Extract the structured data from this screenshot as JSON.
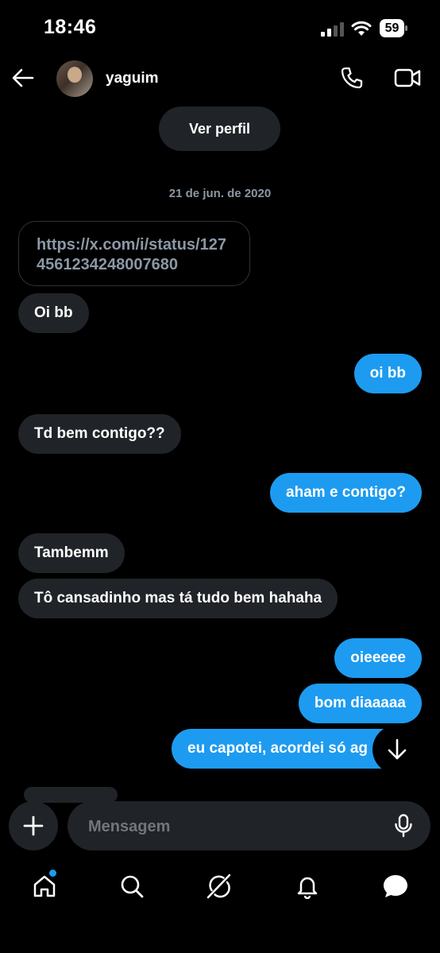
{
  "status_bar": {
    "time": "18:46",
    "battery_level": "59"
  },
  "header": {
    "contact_name": "yaguim"
  },
  "actions": {
    "view_profile": "Ver perfil"
  },
  "conversation": {
    "date": "21 de jun. de 2020",
    "link_message": "https://x.com/i/status/1274561234248007680",
    "messages": [
      {
        "side": "in",
        "text": "Oi bb"
      },
      {
        "side": "out",
        "text": "oi bb"
      },
      {
        "side": "in",
        "text": "Td bem contigo??"
      },
      {
        "side": "out",
        "text": "aham e contigo?"
      },
      {
        "side": "in",
        "text": "Tambemm"
      },
      {
        "side": "in",
        "text": "Tô cansadinho mas tá tudo bem hahaha"
      },
      {
        "side": "out",
        "text": "oieeeee"
      },
      {
        "side": "out",
        "text": "bom diaaaaa"
      },
      {
        "side": "out",
        "text": "eu capotei, acordei só ag"
      }
    ]
  },
  "composer": {
    "placeholder": "Mensagem"
  },
  "nav": {
    "items": [
      "home-icon",
      "search-icon",
      "grok-icon",
      "notifications-icon",
      "messages-icon"
    ],
    "accent": "#1d9bf0"
  },
  "colors": {
    "bubble_out": "#1d9bf0",
    "bubble_in": "#202327",
    "muted": "#8b98a5"
  }
}
